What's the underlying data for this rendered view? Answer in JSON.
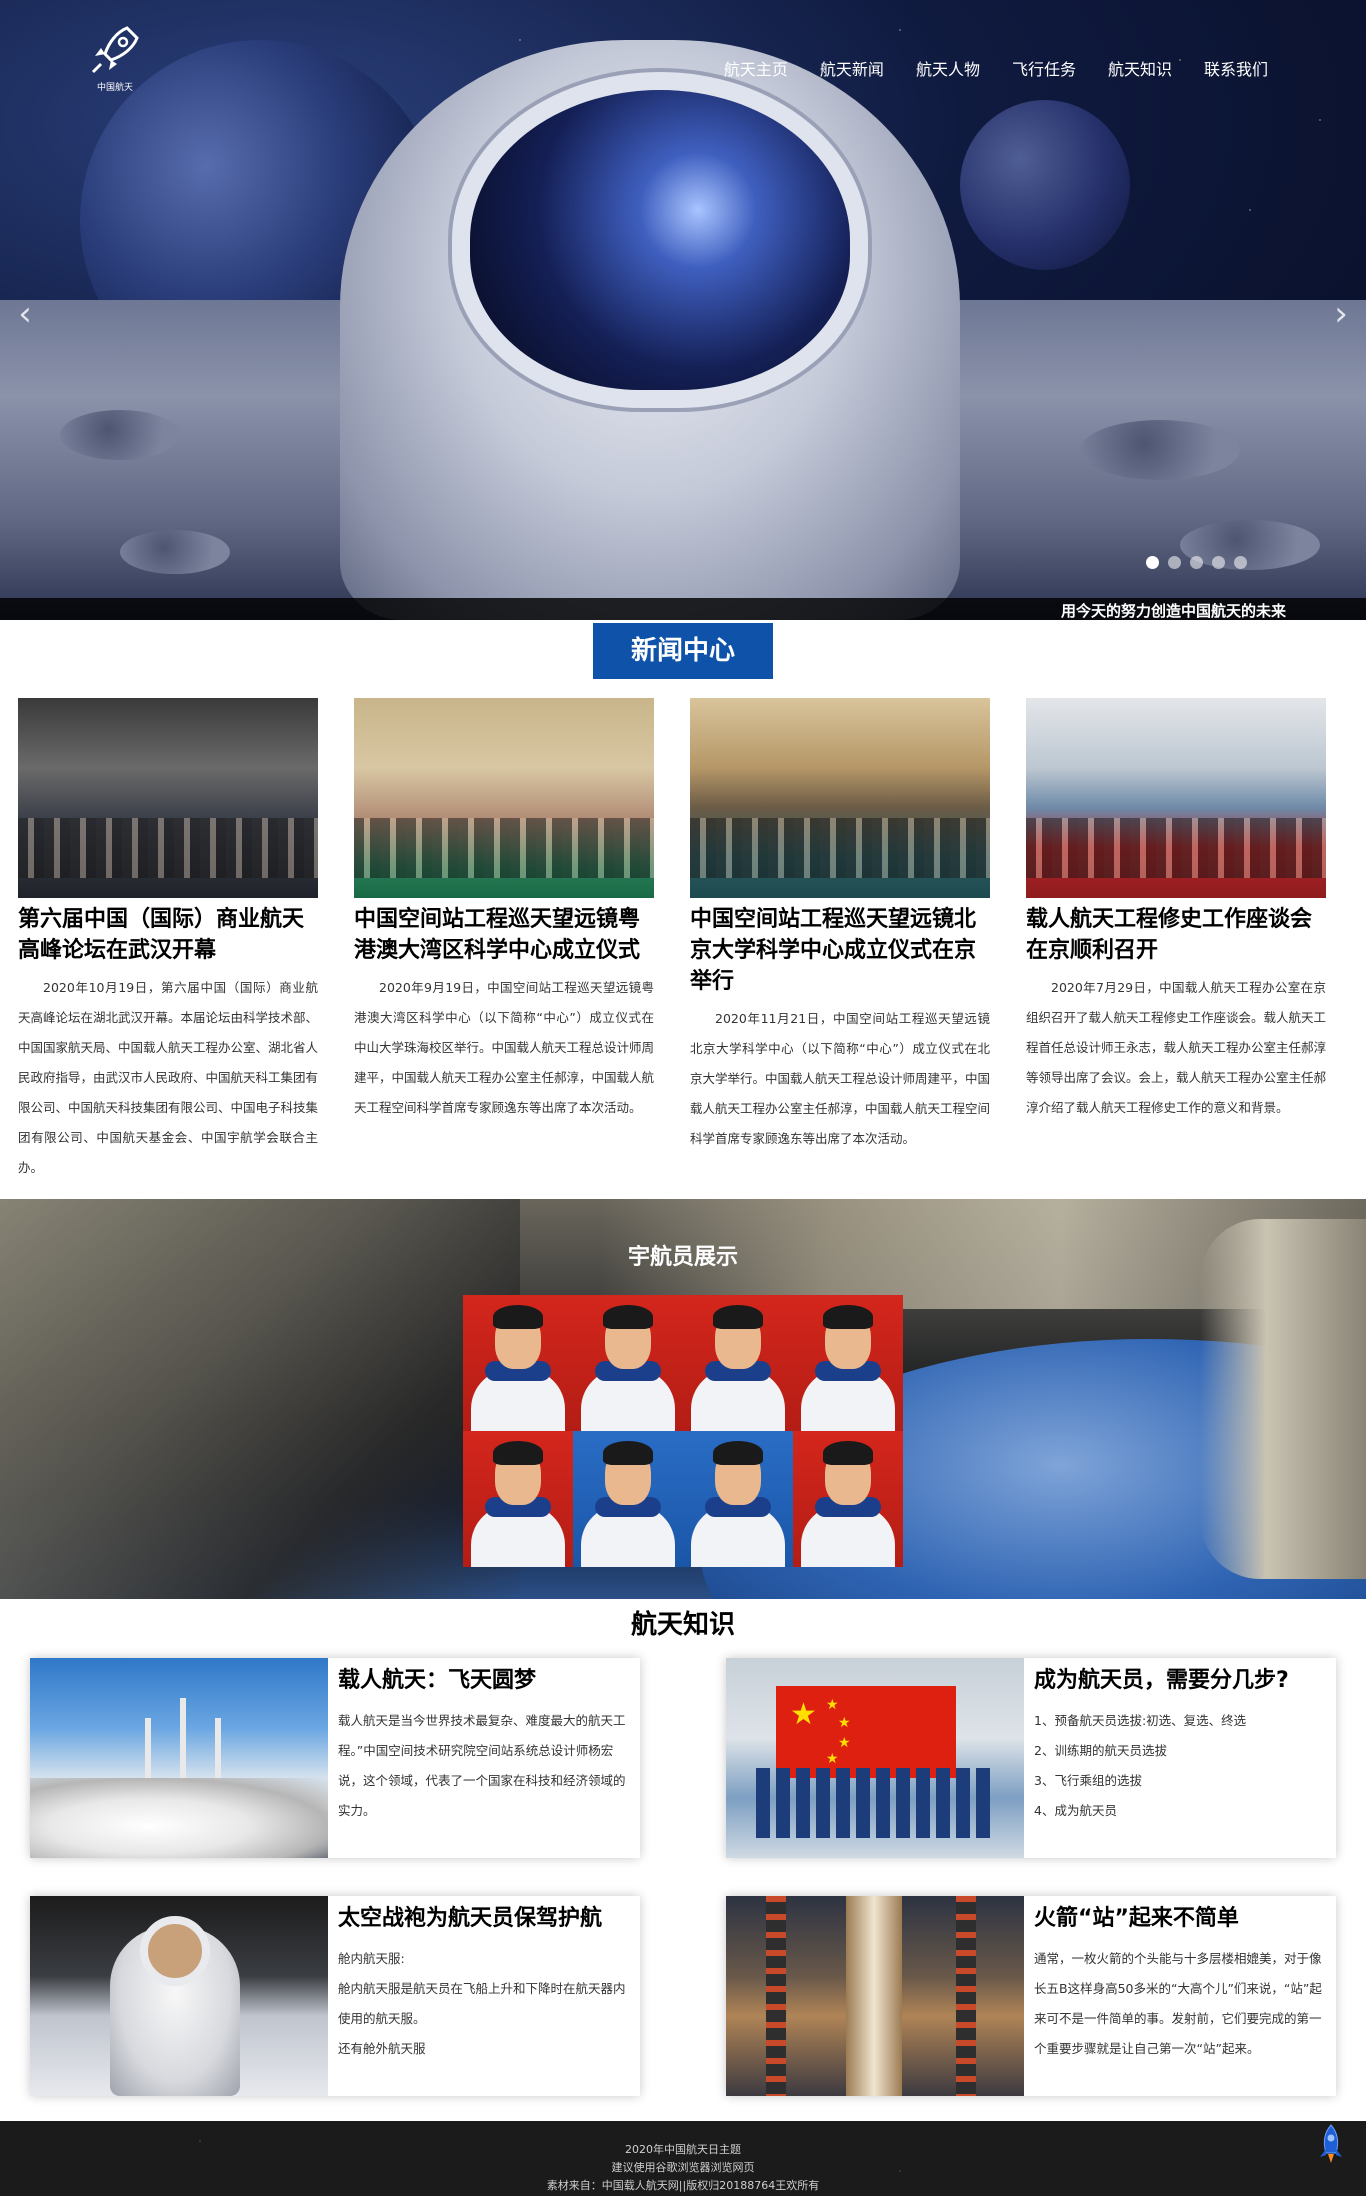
{
  "logo": {
    "text": "中国航天"
  },
  "nav": {
    "items": [
      {
        "label": "航天主页"
      },
      {
        "label": "航天新闻"
      },
      {
        "label": "航天人物"
      },
      {
        "label": "飞行任务"
      },
      {
        "label": "航天知识"
      },
      {
        "label": "联系我们"
      }
    ]
  },
  "hero": {
    "slogan": "用今天的努力创造中国航天的未来",
    "prev_icon": "chevron-left-icon",
    "next_icon": "chevron-right-icon",
    "slide_count": 5,
    "active_slide": 1
  },
  "news": {
    "title": "新闻中心",
    "items": [
      {
        "headline": "第六届中国（国际）商业航天高峰论坛在武汉开幕",
        "body": "2020年10月19日，第六届中国（国际）商业航天高峰论坛在湖北武汉开幕。本届论坛由科学技术部、中国国家航天局、中国载人航天工程办公室、湖北省人民政府指导，由武汉市人民政府、中国航天科工集团有限公司、中国航天科技集团有限公司、中国电子科技集团有限公司、中国航天基金会、中国宇航学会联合主办。"
      },
      {
        "headline": "中国空间站工程巡天望远镜粤港澳大湾区科学中心成立仪式",
        "body": "2020年9月19日，中国空间站工程巡天望远镜粤港澳大湾区科学中心（以下简称“中心”）成立仪式在中山大学珠海校区举行。中国载人航天工程总设计师周建平，中国载人航天工程办公室主任郝淳，中国载人航天工程空间科学首席专家顾逸东等出席了本次活动。"
      },
      {
        "headline": "中国空间站工程巡天望远镜北京大学科学中心成立仪式在京举行",
        "body": "2020年11月21日，中国空间站工程巡天望远镜北京大学科学中心（以下简称“中心”）成立仪式在北京大学举行。中国载人航天工程总设计师周建平，中国载人航天工程办公室主任郝淳，中国载人航天工程空间科学首席专家顾逸东等出席了本次活动。"
      },
      {
        "headline": "载人航天工程修史工作座谈会在京顺利召开",
        "body": "2020年7月29日，中国载人航天工程办公室在京组织召开了载人航天工程修史工作座谈会。载人航天工程首任总设计师王永志，载人航天工程办公室主任郝淳等领导出席了会议。会上，载人航天工程办公室主任郝淳介绍了载人航天工程修史工作的意义和背景。"
      }
    ]
  },
  "astronauts": {
    "title": "宇航员展示",
    "count": 8
  },
  "knowledge": {
    "title": "航天知识",
    "cards": [
      {
        "title": "载人航天：飞天圆梦",
        "body": "载人航天是当今世界技术最复杂、难度最大的航天工程。”中国空间技术研究院空间站系统总设计师杨宏说，这个领域，代表了一个国家在科技和经济领域的实力。"
      },
      {
        "title": "成为航天员，需要分几步?",
        "list": [
          "1、预备航天员选拔:初选、复选、终选",
          "2、训练期的航天员选拔",
          "3、飞行乘组的选拔",
          "4、成为航天员"
        ]
      },
      {
        "title": "太空战袍为航天员保驾护航",
        "lines": [
          "舱内航天服:",
          "舱内航天服是航天员在飞船上升和下降时在航天器内使用的航天服。",
          "还有舱外航天服"
        ]
      },
      {
        "title": "火箭“站”起来不简单",
        "body": "通常，一枚火箭的个头能与十多层楼相媲美，对于像长五B这样身高50多米的“大高个儿”们来说，“站”起来可不是一件简单的事。发射前，它们要完成的第一个重要步骤就是让自己第一次“站”起来。"
      }
    ]
  },
  "footer": {
    "line1": "2020年中国航天日主题",
    "line2": "建议使用谷歌浏览器浏览网页",
    "line3": "素材来自：中国载人航天网||版权归20188764王欢所有",
    "icon": "rocket-icon"
  }
}
